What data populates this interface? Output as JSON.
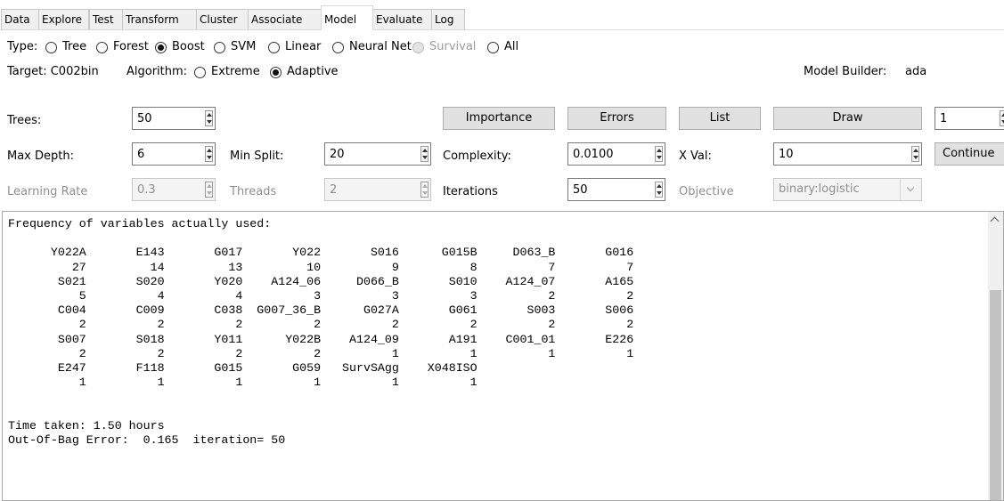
{
  "tabs": [
    "Data",
    "Explore",
    "Test",
    "Transform",
    "Cluster",
    "Associate",
    "Model",
    "Evaluate",
    "Log"
  ],
  "active_tab": "Model",
  "type_row": {
    "label": "Type:",
    "options": [
      {
        "label": "Tree",
        "checked": false,
        "disabled": false
      },
      {
        "label": "Forest",
        "checked": false,
        "disabled": false
      },
      {
        "label": "Boost",
        "checked": true,
        "disabled": false
      },
      {
        "label": "SVM",
        "checked": false,
        "disabled": false
      },
      {
        "label": "Linear",
        "checked": false,
        "disabled": false
      },
      {
        "label": "Neural Net",
        "checked": false,
        "disabled": false
      },
      {
        "label": "Survival",
        "checked": false,
        "disabled": true
      },
      {
        "label": "All",
        "checked": false,
        "disabled": false
      }
    ]
  },
  "target_row": {
    "target": "Target: C002bin",
    "algorithm_label": "Algorithm:",
    "options": [
      {
        "label": "Extreme",
        "checked": false
      },
      {
        "label": "Adaptive",
        "checked": true
      }
    ],
    "model_builder_label": "Model Builder:",
    "model_builder_value": "ada"
  },
  "params": {
    "trees_label": "Trees:",
    "trees_value": "50",
    "importance_button": "Importance",
    "errors_button": "Errors",
    "list_button": "List",
    "draw_button": "Draw",
    "draw_spin_value": "1",
    "max_depth_label": "Max Depth:",
    "max_depth_value": "6",
    "min_split_label": "Min Split:",
    "min_split_value": "20",
    "complexity_label": "Complexity:",
    "complexity_value": "0.0100",
    "xval_label": "X Val:",
    "xval_value": "10",
    "continue_button": "Continue",
    "learning_rate_label": "Learning Rate",
    "learning_rate_value": "0.3",
    "threads_label": "Threads",
    "threads_value": "2",
    "iterations_label": "Iterations",
    "iterations_value": "50",
    "objective_label": "Objective",
    "objective_value": "binary:logistic"
  },
  "output": {
    "heading": "Frequency of variables actually used:",
    "variable_rows": [
      {
        "names": [
          "Y022A",
          "E143",
          "G017",
          "Y022",
          "S016",
          "G015B",
          "D063_B",
          "G016"
        ],
        "counts": [
          "27",
          "14",
          "13",
          "10",
          "9",
          "8",
          "7",
          "7"
        ]
      },
      {
        "names": [
          "S021",
          "S020",
          "Y020",
          "A124_06",
          "D066_B",
          "S010",
          "A124_07",
          "A165"
        ],
        "counts": [
          "5",
          "4",
          "4",
          "3",
          "3",
          "3",
          "2",
          "2"
        ]
      },
      {
        "names": [
          "C004",
          "C009",
          "C038",
          "G007_36_B",
          "G027A",
          "G061",
          "S003",
          "S006"
        ],
        "counts": [
          "2",
          "2",
          "2",
          "2",
          "2",
          "2",
          "2",
          "2"
        ]
      },
      {
        "names": [
          "S007",
          "S018",
          "Y011",
          "Y022B",
          "A124_09",
          "A191",
          "C001_01",
          "E226"
        ],
        "counts": [
          "2",
          "2",
          "2",
          "2",
          "1",
          "1",
          "1",
          "1"
        ]
      },
      {
        "names": [
          "E247",
          "F118",
          "G015",
          "G059",
          "SurvSAgg",
          "X048ISO"
        ],
        "counts": [
          "1",
          "1",
          "1",
          "1",
          "1",
          "1"
        ]
      }
    ],
    "time_taken": "Time taken: 1.50 hours",
    "oob_error": "Out-Of-Bag Error:  0.165  iteration= 50"
  }
}
